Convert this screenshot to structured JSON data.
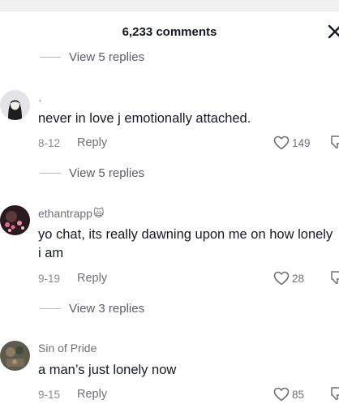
{
  "header": {
    "title": "6,233 comments",
    "close_icon": "close-icon"
  },
  "colors": {
    "text": "#161823",
    "secondary": "#6e6f76",
    "muted": "#8a8b91",
    "rule": "#b9babd"
  },
  "threads": [
    {
      "view_replies": "View 5 replies"
    },
    {
      "username": "·",
      "text": "never in love j emotionally attached.",
      "date": "8-12",
      "reply": "Reply",
      "likes": "149",
      "view_replies": "View 5 replies"
    },
    {
      "username": "ethantrapp",
      "badge": "🙀",
      "text": "yo chat, its really dawning upon me on how lonely i am",
      "date": "9-19",
      "reply": "Reply",
      "likes": "28",
      "view_replies": "View 3 replies"
    },
    {
      "username": "Sin of Pride",
      "text": "a man’s just lonely now",
      "date": "9-15",
      "reply": "Reply",
      "likes": "85"
    }
  ]
}
